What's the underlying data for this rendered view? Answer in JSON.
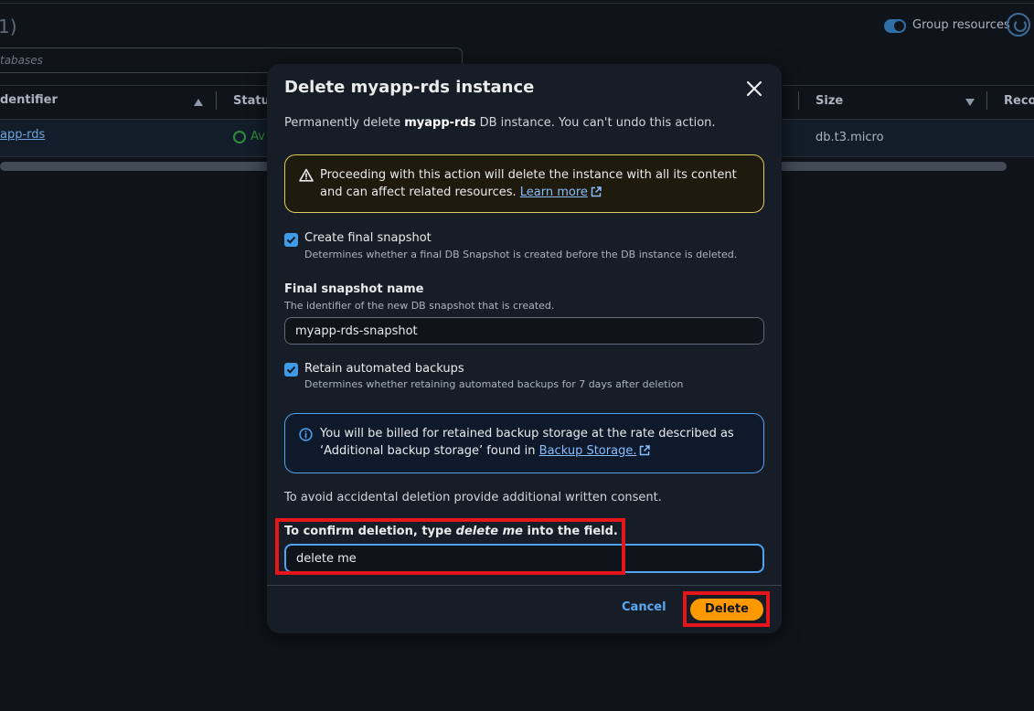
{
  "background": {
    "count": "1)",
    "group_resources_label": "Group resources",
    "search_placeholder": "tabases",
    "columns": {
      "identifier": "dentifier",
      "status": "Status",
      "size": "Size",
      "recommendations": "Recom"
    },
    "row": {
      "identifier": "app-rds",
      "status": "Av",
      "size": "db.t3.micro"
    }
  },
  "modal": {
    "title": "Delete myapp-rds instance",
    "desc_pre": "Permanently delete ",
    "desc_name": "myapp-rds",
    "desc_post": " DB instance. You can't undo this action.",
    "warning_text": "Proceeding with this action will delete the instance with all its content and can affect related resources. ",
    "warning_link": "Learn more",
    "final_snapshot": {
      "checked": true,
      "label": "Create final snapshot",
      "desc": "Determines whether a final DB Snapshot is created before the DB instance is deleted."
    },
    "snapshot_name": {
      "label": "Final snapshot name",
      "desc": "The identifier of the new DB snapshot that is created.",
      "value": "myapp-rds-snapshot"
    },
    "retain_backups": {
      "checked": true,
      "label": "Retain automated backups",
      "desc": "Determines whether retaining automated backups for 7 days after deletion"
    },
    "info_text": "You will be billed for retained backup storage at the rate described as ‘Additional backup storage’ found in ",
    "info_link": "Backup Storage.",
    "consent_text": "To avoid accidental deletion provide additional written consent.",
    "confirm_pre": "To confirm deletion, type ",
    "confirm_phrase": "delete me",
    "confirm_post": " into the field.",
    "confirm_value": "delete me",
    "cancel_label": "Cancel",
    "delete_label": "Delete"
  },
  "colors": {
    "primary_button": "#ff9900",
    "link": "#89bdff",
    "warning_border": "#e0ca57",
    "info_border": "#4fa3f2",
    "highlight": "#e4161c"
  }
}
